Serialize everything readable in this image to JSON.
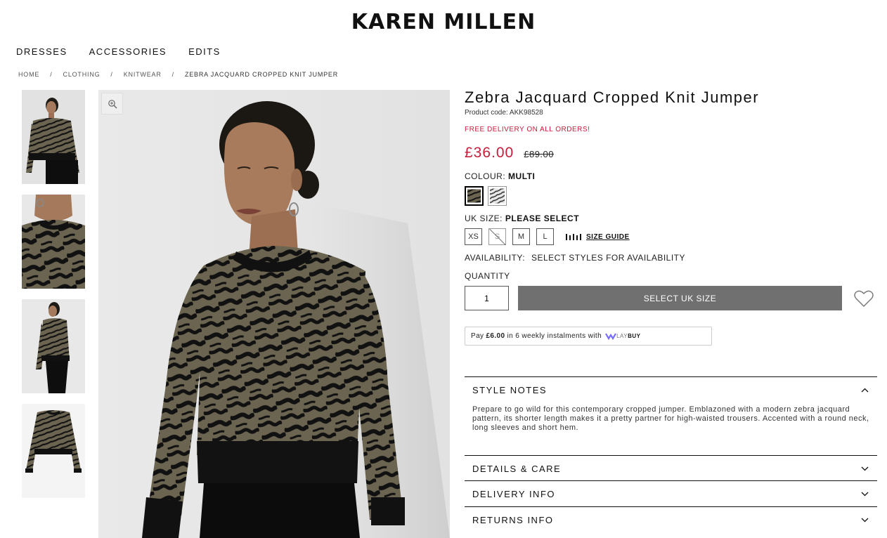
{
  "brand": "KAREN MILLEN",
  "nav": [
    "DRESSES",
    "ACCESSORIES",
    "EDITS"
  ],
  "breadcrumb": [
    "HOME",
    "CLOTHING",
    "KNITWEAR",
    "ZEBRA JACQUARD CROPPED KNIT JUMPER"
  ],
  "breadcrumb_separator": "/",
  "product": {
    "title": "Zebra Jacquard Cropped Knit Jumper",
    "code": "Product code: AKK98528",
    "delivery_note": "FREE DELIVERY ON ALL ORDERS!",
    "price_now": "£36.00",
    "price_was": "£89.00",
    "price_color": "#c41e3a",
    "colour_label": "COLOUR:",
    "colour_value": "MULTI",
    "swatches": [
      "khaki-black-zebra",
      "grey-white-zebra"
    ],
    "size_label": "UK SIZE:",
    "size_value": "PLEASE SELECT",
    "sizes": [
      "XS",
      "S",
      "M",
      "L"
    ],
    "out_of_stock_sizes": [
      "S"
    ],
    "size_guide": "SIZE GUIDE",
    "availability_label": "AVAILABILITY:",
    "availability_value": "SELECT STYLES FOR AVAILABILITY",
    "quantity_label": "QUANTITY",
    "quantity_value": "1",
    "buy_button": "SELECT UK SIZE",
    "buy_button_color": "#707070"
  },
  "laybuy": {
    "prefix": "Pay",
    "amount": "£6.00",
    "suffix": "in 6 weekly instalments with",
    "logo_light": "LAY",
    "logo_bold": "BUY"
  },
  "accordion": [
    {
      "title": "STYLE NOTES",
      "open": true,
      "body": "Prepare to go wild for this contemporary cropped jumper. Emblazoned with a modern zebra jacquard pattern, its shorter length makes it a pretty partner for high-waisted trousers. Accented with a round neck, long sleeves and short hem."
    },
    {
      "title": "DETAILS & CARE",
      "open": false
    },
    {
      "title": "DELIVERY INFO",
      "open": false
    },
    {
      "title": "RETURNS INFO",
      "open": false
    }
  ],
  "icons": [
    "zoom-icon",
    "ruler-icon",
    "heart-icon",
    "chevron-up-icon",
    "chevron-down-icon",
    "laybuy-logo-icon"
  ]
}
